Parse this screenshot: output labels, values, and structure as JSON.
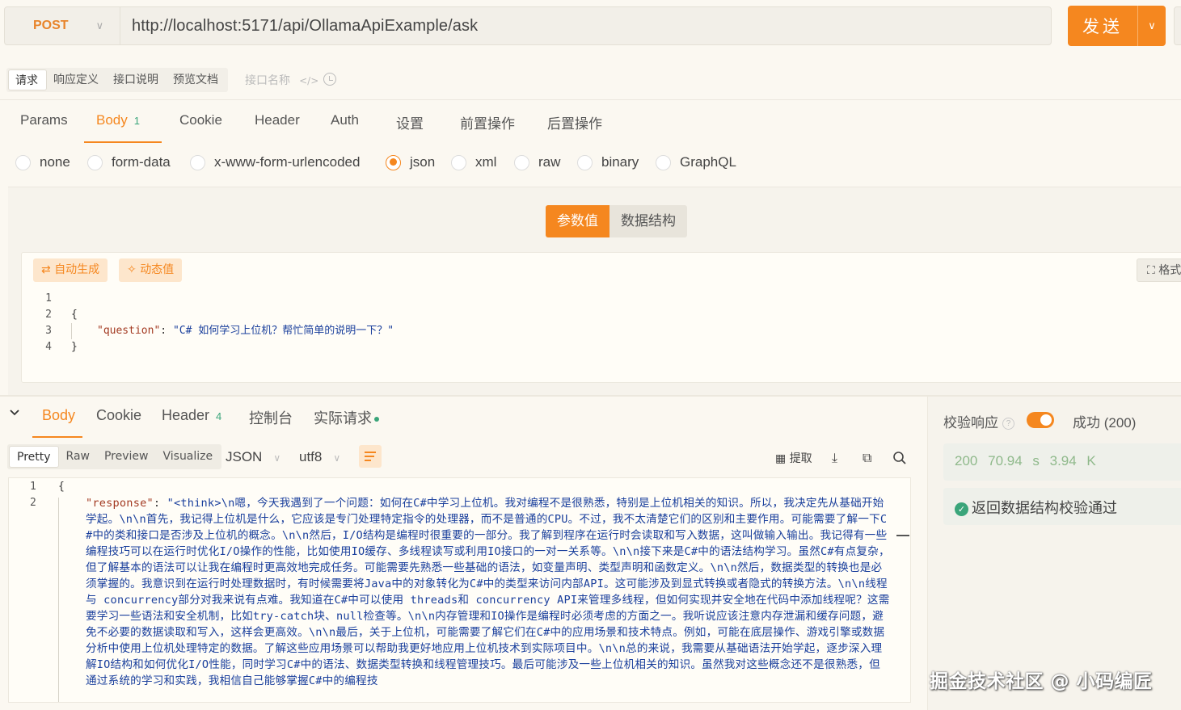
{
  "request": {
    "method": "POST",
    "url": "http://localhost:5171/api/OllamaApiExample/ask",
    "send_label": "发送"
  },
  "doc_tabs": [
    "请求",
    "响应定义",
    "接口说明",
    "预览文档"
  ],
  "doc_tab_hint": "接口名称",
  "request_tabs": {
    "params": "Params",
    "body": "Body",
    "body_count": "1",
    "cookie": "Cookie",
    "header": "Header",
    "auth": "Auth",
    "settings": "设置",
    "pre": "前置操作",
    "post": "后置操作"
  },
  "body_types": {
    "none": "none",
    "form_data": "form-data",
    "urlencoded": "x-www-form-urlencoded",
    "json": "json",
    "xml": "xml",
    "raw": "raw",
    "binary": "binary",
    "graphql": "GraphQL",
    "selected": "json"
  },
  "body_mode": {
    "values": "参数值",
    "schema": "数据结构"
  },
  "editor_tools": {
    "auto_generate": "自动生成",
    "dynamic_value": "动态值",
    "format": "格式"
  },
  "request_body": {
    "line_numbers": [
      "1",
      "2",
      "3",
      "4"
    ],
    "open_brace": "{",
    "key": "\"question\"",
    "colon": ": ",
    "value": "\"C# 如何学习上位机？帮忙简单的说明一下？\"",
    "close_brace": "}"
  },
  "response_tabs": {
    "body": "Body",
    "cookie": "Cookie",
    "header": "Header",
    "header_count": "4",
    "console": "控制台",
    "actual_request": "实际请求"
  },
  "view_tabs": [
    "Pretty",
    "Raw",
    "Preview",
    "Visualize"
  ],
  "format_select": "JSON",
  "encoding_select": "utf8",
  "toolbar": {
    "extract": "提取"
  },
  "response_body": {
    "line_numbers": [
      "1",
      "2"
    ],
    "open_brace": "{",
    "key": "\"response\"",
    "colon": ": ",
    "value": "\"<think>\\n嗯，今天我遇到了一个问题：如何在C#中学习上位机。我对编程不是很熟悉，特别是上位机相关的知识。所以，我决定先从基础开始学起。\\n\\n首先，我记得上位机是什么，它应该是专门处理特定指令的处理器，而不是普通的CPU。不过，我不太清楚它们的区别和主要作用。可能需要了解一下C#中的类和接口是否涉及上位机的概念。\\n\\n然后，I/O结构是编程时很重要的一部分。我了解到程序在运行时会读取和写入数据，这叫做输入输出。我记得有一些编程技巧可以在运行时优化I/O操作的性能，比如使用IO缓存、多线程读写或利用IO接口的一对一关系等。\\n\\n接下来是C#中的语法结构学习。虽然C#有点复杂，但了解基本的语法可以让我在编程时更高效地完成任务。可能需要先熟悉一些基础的语法，如变量声明、类型声明和函数定义。\\n\\n然后，数据类型的转换也是必须掌握的。我意识到在运行时处理数据时，有时候需要将Java中的对象转化为C#中的类型来访问内部API。这可能涉及到显式转换或者隐式的转换方法。\\n\\n线程与 concurrency部分对我来说有点难。我知道在C#中可以使用 threads和 concurrency API来管理多线程，但如何实现并安全地在代码中添加线程呢？这需要学习一些语法和安全机制，比如try-catch块、null检查等。\\n\\n内存管理和IO操作是编程时必须考虑的方面之一。我听说应该注意内存泄漏和缓存问题，避免不必要的数据读取和写入，这样会更高效。\\n\\n最后，关于上位机，可能需要了解它们在C#中的应用场景和技术特点。例如，可能在底层操作、游戏引擎或数据分析中使用上位机处理特定的数据。了解这些应用场景可以帮助我更好地应用上位机技术到实际项目中。\\n\\n总的来说，我需要从基础语法开始学起，逐步深入理解IO结构和如何优化I/O性能，同时学习C#中的语法、数据类型转换和线程管理技巧。最后可能涉及一些上位机相关的知识。虽然我对这些概念还不是很熟悉，但通过系统的学习和实践，我相信自己能够掌握C#中的编程技"
  },
  "verify": {
    "label": "校验响应",
    "status": "成功 (200)"
  },
  "metrics": {
    "status_code": "200",
    "time": "70.94 s",
    "size": "3.94 K"
  },
  "schema_check": "返回数据结构校验通过",
  "watermark": "掘金技术社区 @ 小码编匠",
  "colors": {
    "accent": "#f5871f",
    "success": "#3aa57a"
  }
}
